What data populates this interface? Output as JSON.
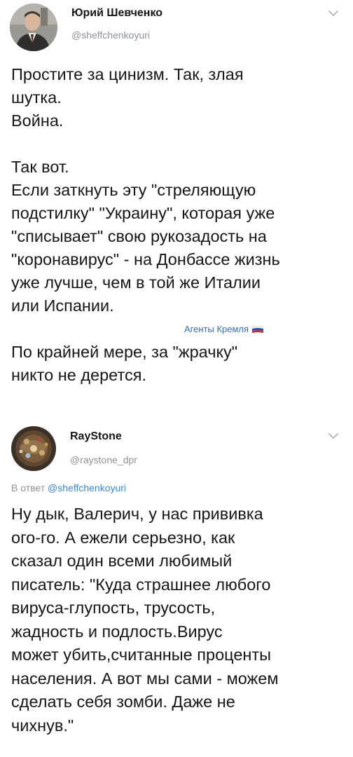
{
  "tweets": [
    {
      "author": {
        "name": "Юрий Шевченко",
        "handle": "@sheffchenkoyuri"
      },
      "paragraphs": [
        [
          "Простите за цинизм. Так, злая",
          "шутка.",
          "Война."
        ],
        [
          "Так вот.",
          "Если заткнуть эту \"стреляющую",
          "подстилку\" \"Украину\", которая уже",
          "\"списывает\" свою рукозадость на",
          "\"коронавирус\" - на Донбассе жизнь",
          "уже лучше, чем в той же Италии",
          "или Испании."
        ],
        [
          "По крайней мере, за \"жрачку\"",
          "никто не дерется."
        ]
      ]
    },
    {
      "author": {
        "name": "RayStone",
        "handle": "@raystone_dpr"
      },
      "reply": {
        "prefix": "В ответ ",
        "mention": "@sheffchenkoyuri"
      },
      "paragraphs": [
        [
          "Ну дык, Валерич, у нас прививка",
          "ого-го. А ежели серьезно, как",
          "сказал один всеми любимый",
          "писатель: \"Куда страшнее любого",
          "вируса-глупость, трусость,",
          "жадность и подлость.Вирус",
          "может убить,считанные проценты",
          "населения. А вот мы сами - можем",
          "сделать себя зомби. Даже не",
          "чихнув.\""
        ]
      ]
    }
  ],
  "watermark": {
    "text": "Агенты Кремля",
    "icon": "russian-flag-icon"
  },
  "colors": {
    "text": "#14171a",
    "muted": "#8f959b",
    "link": "#3b88d6",
    "watermark": "#3a6fb0"
  },
  "icons": {
    "menu": "chevron-down-icon"
  }
}
